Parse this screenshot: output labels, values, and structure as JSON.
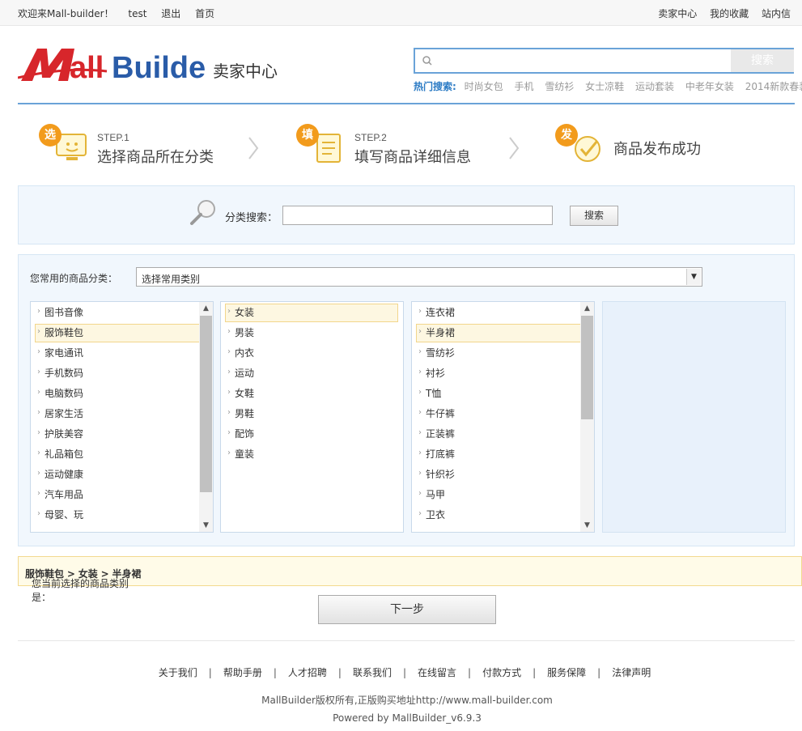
{
  "topbar": {
    "welcome": "欢迎来Mall-builder！",
    "user": "test",
    "logout": "退出",
    "home": "首页",
    "seller_center": "卖家中心",
    "favorites": "我的收藏",
    "messages": "站内信"
  },
  "header": {
    "logo_text": "MallBuilder",
    "seller_center_label": "卖家中心",
    "search_placeholder": "",
    "search_button": "搜索",
    "hot_label": "热门搜索:",
    "hot_words": [
      "时尚女包",
      "手机",
      "雪纺衫",
      "女士凉鞋",
      "运动套装",
      "中老年女装",
      "2014新款春装"
    ]
  },
  "steps": [
    {
      "badge": "选",
      "num": "STEP.1",
      "text": "选择商品所在分类"
    },
    {
      "badge": "填",
      "num": "STEP.2",
      "text": "填写商品详细信息"
    },
    {
      "badge": "发",
      "num": "",
      "text": "商品发布成功"
    }
  ],
  "category_search": {
    "label": "分类搜索：",
    "input_value": "",
    "button": "搜索"
  },
  "common": {
    "label": "您常用的商品分类：",
    "selected": "选择常用类别"
  },
  "columns": {
    "level1": [
      "图书音像",
      "服饰鞋包",
      "家电通讯",
      "手机数码",
      "电脑数码",
      "居家生活",
      "护肤美容",
      "礼品箱包",
      "运动健康",
      "汽车用品",
      "母婴、玩"
    ],
    "level2": [
      "女装",
      "男装",
      "内衣",
      "运动",
      "女鞋",
      "男鞋",
      "配饰",
      "童装"
    ],
    "level3": [
      "连衣裙",
      "半身裙",
      "雪纺衫",
      "衬衫",
      "T恤",
      "牛仔裤",
      "正装裤",
      "打底裤",
      "针织衫",
      "马甲",
      "卫衣"
    ]
  },
  "current": {
    "prefix": "您当前选择的商品类别是：",
    "cat1": "服饰鞋包",
    "sep": ">",
    "cat2": "女装",
    "cat3": "半身裙"
  },
  "next_button": "下一步",
  "footer": {
    "links": [
      "关于我们",
      "帮助手册",
      "人才招聘",
      "联系我们",
      "在线留言",
      "付款方式",
      "服务保障",
      "法律声明"
    ],
    "separator": "|",
    "copyright": "MallBuilder版权所有,正版购买地址http://www.mall-builder.com",
    "powered": "Powered by MallBuilder_v6.9.3"
  },
  "colors": {
    "brand_red": "#d7262b",
    "brand_blue": "#2a7ac4",
    "badge_orange": "#f29b1c",
    "selected_bg": "#fdf7e1"
  }
}
